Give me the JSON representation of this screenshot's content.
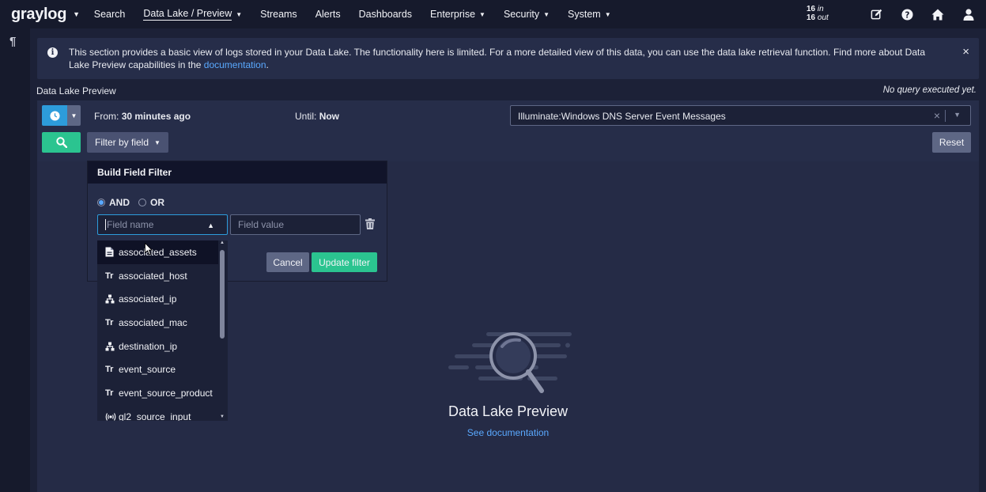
{
  "nav": {
    "logo": "graylog",
    "items": [
      {
        "label": "Search",
        "has_caret": false
      },
      {
        "label": "Data Lake / Preview",
        "has_caret": true
      },
      {
        "label": "Streams",
        "has_caret": false
      },
      {
        "label": "Alerts",
        "has_caret": false
      },
      {
        "label": "Dashboards",
        "has_caret": false
      },
      {
        "label": "Enterprise",
        "has_caret": true
      },
      {
        "label": "Security",
        "has_caret": true
      },
      {
        "label": "System",
        "has_caret": true
      }
    ],
    "throughput": {
      "in_count": "16",
      "in_label": "in",
      "out_count": "16",
      "out_label": "out"
    },
    "icons": [
      "edit-icon",
      "help-icon",
      "home-icon",
      "user-icon"
    ]
  },
  "banner": {
    "text_before": "This section provides a basic view of logs stored in your Data Lake. The functionality here is limited. For a more detailed view of this data, you can use the data lake retrieval function. Find more about Data Lake Preview capabilities in the ",
    "link": "documentation",
    "text_after": ".",
    "close": "×"
  },
  "page": {
    "title": "Data Lake Preview",
    "query_status": "No query executed yet."
  },
  "query": {
    "from_label": "From:",
    "from_value": "30 minutes ago",
    "until_label": "Until:",
    "until_value": "Now",
    "stream_value": "Illuminate:Windows DNS Server Event Messages",
    "stream_clear": "×",
    "filter_button": "Filter by field",
    "reset_button": "Reset"
  },
  "filter": {
    "title": "Build Field Filter",
    "and_label": "AND",
    "or_label": "OR",
    "field_name_placeholder": "Field name",
    "field_value_placeholder": "Field value",
    "cancel": "Cancel",
    "update": "Update filter",
    "fields": [
      {
        "name": "associated_assets",
        "type_icon": "document-icon"
      },
      {
        "name": "associated_host",
        "type_icon": "text-type-icon"
      },
      {
        "name": "associated_ip",
        "type_icon": "network-icon"
      },
      {
        "name": "associated_mac",
        "type_icon": "text-type-icon"
      },
      {
        "name": "destination_ip",
        "type_icon": "network-icon"
      },
      {
        "name": "event_source",
        "type_icon": "text-type-icon"
      },
      {
        "name": "event_source_product",
        "type_icon": "text-type-icon"
      },
      {
        "name": "gl2_source_input",
        "type_icon": "broadcast-icon"
      }
    ],
    "text_type_glyph": "Tr"
  },
  "empty_state": {
    "title": "Data Lake Preview",
    "link": "See documentation"
  },
  "colors": {
    "background": "#1c2137",
    "panel": "#262d49",
    "accent_blue": "#2d9cdb",
    "accent_green": "#2bc490",
    "link": "#5aa9ff"
  }
}
